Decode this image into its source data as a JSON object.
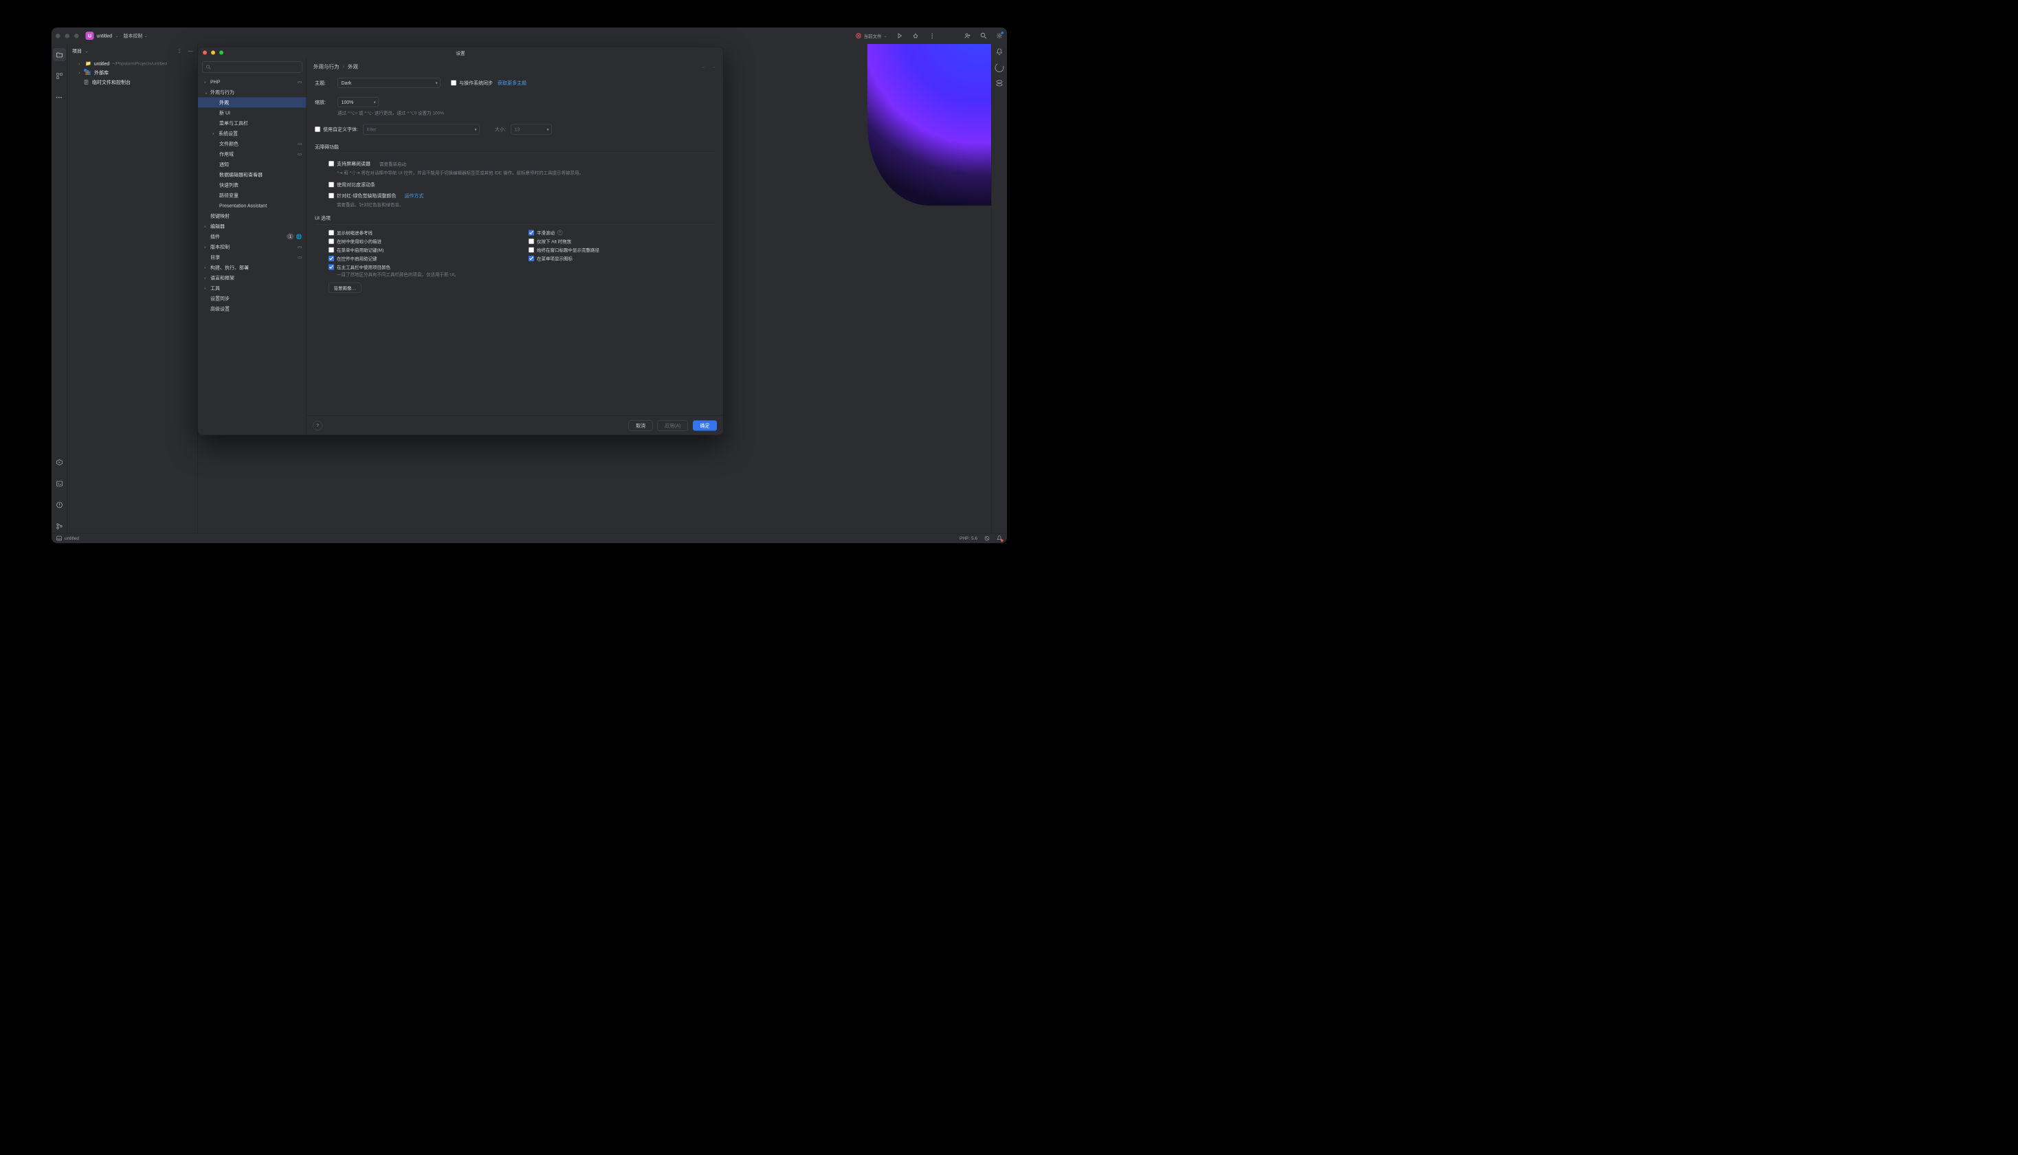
{
  "titlebar": {
    "project_badge": "U",
    "project_name": "untitled",
    "vcs_menu": "版本控制",
    "run_config": "当前文件"
  },
  "project_panel": {
    "header": "项目",
    "root_name": "untitled",
    "root_path": "~/PhpstormProjects/untitled",
    "external_libs": "外部库",
    "scratches": "临时文件和控制台"
  },
  "statusbar": {
    "file": "untitled",
    "php": "PHP: 5.6"
  },
  "dialog": {
    "title": "设置",
    "search_placeholder": "",
    "nav": {
      "php": "PHP",
      "appearance_behavior": "外观与行为",
      "appearance": "外观",
      "new_ui": "新 UI",
      "menus_toolbars": "菜单与工具栏",
      "system_settings": "系统设置",
      "file_colors": "文件颜色",
      "scopes": "作用域",
      "notifications": "通知",
      "data_editor": "数据编辑器和查看器",
      "quick_lists": "快速列表",
      "path_vars": "路径变量",
      "presentation": "Presentation Assistant",
      "keymap": "按键映射",
      "editor": "编辑器",
      "plugins": "插件",
      "plugins_badge": "1",
      "version_control": "版本控制",
      "directories": "目录",
      "build": "构建、执行、部署",
      "languages": "语言和框架",
      "tools": "工具",
      "settings_sync": "设置同步",
      "advanced": "高级设置"
    },
    "breadcrumb": {
      "group": "外观与行为",
      "page": "外观"
    },
    "theme": {
      "label": "主题:",
      "value": "Dark",
      "sync_os": "与操作系统同步",
      "get_more": "获取更多主题"
    },
    "zoom": {
      "label": "缩放:",
      "value": "100%",
      "hint": "通过 ^⌥= 或 ^⌥- 进行更改。通过 ^⌥0 设置为 100%"
    },
    "font": {
      "custom_label": "使用自定义字体:",
      "value": "Inter",
      "size_label": "大小:",
      "size_value": "13"
    },
    "a11y": {
      "header": "无障碍功能",
      "screen_reader": "支持屏幕阅读器",
      "screen_reader_hint": "需要重新启动",
      "screen_reader_desc": "^⇥ 和 ^⇧⇥ 将在对话框中导航 UI 控件，并且不能用于切换编辑器标签页或其他 IDE 操作。鼠标悬停时的工具提示将被禁用。",
      "contrast_scroll": "使用对比度滚动条",
      "color_deficiency": "针对红-绿色觉缺陷调整颜色",
      "how_it_works": "运作方式",
      "color_hint": "需要重启。针对红色盲和绿色盲。"
    },
    "ui": {
      "header": "UI 选项",
      "tree_guides": "显示树缩进参考线",
      "smaller_indents": "在树中使用较小的缩进",
      "menu_mnemonics": "在菜单中启用助记键(M)",
      "control_mnemonics": "在控件中启用助记键",
      "project_color": "在主工具栏中使用项目颜色",
      "project_color_hint": "一目了然地区分具有不同工具栏颜色的项目。仅适用于新 UI。",
      "smooth_scroll": "平滑滚动",
      "alt_dnd": "仅按下 Alt 时拖放",
      "full_path_title": "始终在窗口标题中显示完整路径",
      "menu_icons": "在菜单项显示图标",
      "bg_image": "背景图像…"
    },
    "footer": {
      "cancel": "取消",
      "apply": "应用(A)",
      "ok": "确定"
    }
  }
}
